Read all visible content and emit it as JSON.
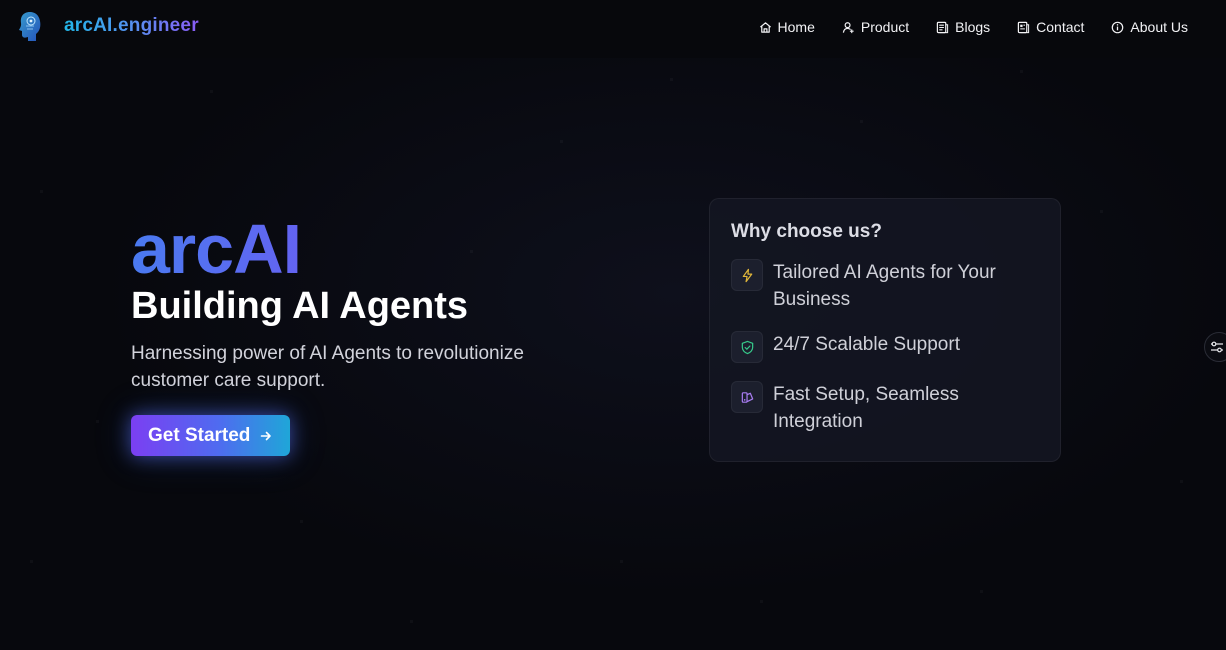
{
  "header": {
    "brand_name": "arcAI.engineer",
    "logo_icon": "ai-head-logo-icon"
  },
  "nav": {
    "items": [
      {
        "label": "Home",
        "icon": "home-icon"
      },
      {
        "label": "Product",
        "icon": "user-icon"
      },
      {
        "label": "Blogs",
        "icon": "document-icon"
      },
      {
        "label": "Contact",
        "icon": "contact-card-icon"
      },
      {
        "label": "About Us",
        "icon": "info-icon"
      }
    ]
  },
  "hero": {
    "brand": "arcAI",
    "title": "Building AI Agents",
    "subtitle": "Harnessing power of AI Agents to revolutionize customer care support.",
    "cta_label": "Get Started",
    "cta_icon": "arrow-right-icon"
  },
  "why_card": {
    "heading": "Why choose us?",
    "items": [
      {
        "text": "Tailored AI Agents for Your Business",
        "icon": "lightning-icon",
        "icon_color": "#e0b63a"
      },
      {
        "text": "24/7 Scalable Support",
        "icon": "shield-check-icon",
        "icon_color": "#36c98a"
      },
      {
        "text": "Fast Setup, Seamless Integration",
        "icon": "layers-icon",
        "icon_color": "#a87cf2"
      }
    ]
  },
  "side_toggle": {
    "icon": "sliders-icon"
  },
  "colors": {
    "background": "#07080d",
    "brand_gradient_start": "#22b7e8",
    "brand_gradient_end": "#8a5cf6",
    "cta_gradient_start": "#7b3ff2",
    "cta_gradient_end": "#1fa6d8"
  }
}
